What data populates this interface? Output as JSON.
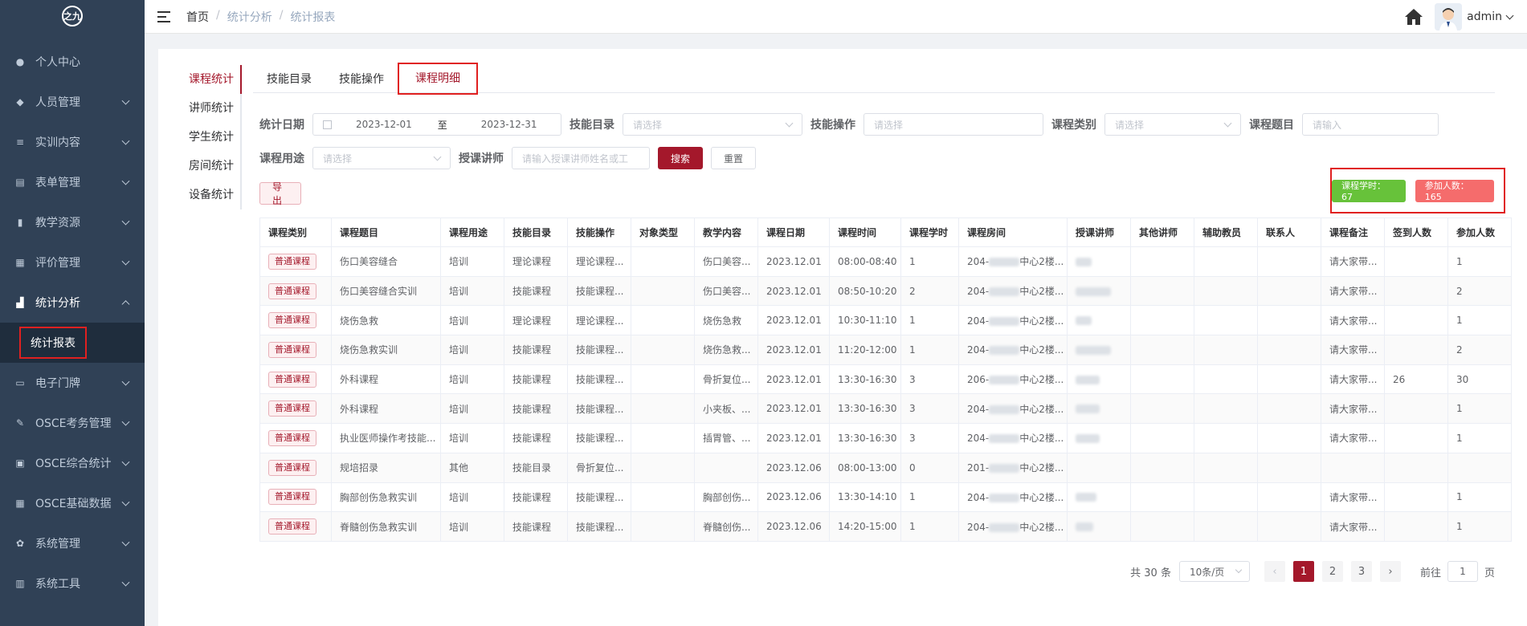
{
  "sidebar": {
    "logo": "之九",
    "items": [
      {
        "label": "个人中心",
        "icon": "user-icon",
        "has_children": false
      },
      {
        "label": "人员管理",
        "icon": "users-icon",
        "has_children": true
      },
      {
        "label": "实训内容",
        "icon": "list-icon",
        "has_children": true
      },
      {
        "label": "表单管理",
        "icon": "form-icon",
        "has_children": true
      },
      {
        "label": "教学资源",
        "icon": "book-icon",
        "has_children": true
      },
      {
        "label": "评价管理",
        "icon": "clipboard-icon",
        "has_children": true
      },
      {
        "label": "统计分析",
        "icon": "bar-chart-icon",
        "has_children": true,
        "open": true
      },
      {
        "label": "电子门牌",
        "icon": "monitor-icon",
        "has_children": true
      },
      {
        "label": "OSCE考务管理",
        "icon": "edit-icon",
        "has_children": true
      },
      {
        "label": "OSCE综合统计",
        "icon": "screen-icon",
        "has_children": true
      },
      {
        "label": "OSCE基础数据",
        "icon": "grid-icon",
        "has_children": true
      },
      {
        "label": "系统管理",
        "icon": "gear-icon",
        "has_children": true
      },
      {
        "label": "系统工具",
        "icon": "toolbox-icon",
        "has_children": true
      }
    ],
    "active_sub": "统计报表"
  },
  "header": {
    "breadcrumb": [
      "首页",
      "统计分析",
      "统计报表"
    ],
    "username": "admin"
  },
  "left_nav": [
    "课程统计",
    "讲师统计",
    "学生统计",
    "房间统计",
    "设备统计"
  ],
  "tabs": [
    "技能目录",
    "技能操作",
    "课程明细"
  ],
  "filters": {
    "date_label": "统计日期",
    "date_start": "2023-12-01",
    "date_sep": "至",
    "date_end": "2023-12-31",
    "skill_dir_label": "技能目录",
    "skill_dir_placeholder": "请选择",
    "skill_op_label": "技能操作",
    "skill_op_placeholder": "请选择",
    "course_type_label": "课程类别",
    "course_type_placeholder": "请选择",
    "course_title_label": "课程题目",
    "course_title_placeholder": "请输入",
    "purpose_label": "课程用途",
    "purpose_placeholder": "请选择",
    "teacher_label": "授课讲师",
    "teacher_placeholder": "请输入授课讲师姓名或工",
    "search_btn": "搜索",
    "reset_btn": "重置",
    "export_btn": "导出"
  },
  "stats": {
    "hours": "课程学时：  67",
    "attendees": "参加人数：  165"
  },
  "table": {
    "columns": [
      "课程类别",
      "课程题目",
      "课程用途",
      "技能目录",
      "技能操作",
      "对象类型",
      "教学内容",
      "课程日期",
      "课程时间",
      "课程学时",
      "课程房间",
      "授课讲师",
      "其他讲师",
      "辅助教员",
      "联系人",
      "课程备注",
      "签到人数",
      "参加人数"
    ],
    "rows": [
      {
        "type": "普通课程",
        "title": "伤口美容缝合",
        "purpose": "培训",
        "skill_dir": "理论课程",
        "skill_op": "理论课程...",
        "obj": "",
        "content": "伤口美容...",
        "date": "2023.12.01",
        "time": "08:00-08:40",
        "hours": "1",
        "room_a": "204-",
        "room_b": "中心2楼...",
        "teacher_w": 20,
        "note": "请大家带...",
        "signed": "",
        "attend": "1"
      },
      {
        "type": "普通课程",
        "title": "伤口美容缝合实训",
        "purpose": "培训",
        "skill_dir": "技能课程",
        "skill_op": "技能课程...",
        "obj": "",
        "content": "伤口美容...",
        "date": "2023.12.01",
        "time": "08:50-10:20",
        "hours": "2",
        "room_a": "204-",
        "room_b": "中心2楼...",
        "teacher_w": 44,
        "note": "请大家带...",
        "signed": "",
        "attend": "2"
      },
      {
        "type": "普通课程",
        "title": "烧伤急救",
        "purpose": "培训",
        "skill_dir": "理论课程",
        "skill_op": "理论课程...",
        "obj": "",
        "content": "烧伤急救",
        "date": "2023.12.01",
        "time": "10:30-11:10",
        "hours": "1",
        "room_a": "204-",
        "room_b": "中心2楼...",
        "teacher_w": 20,
        "note": "请大家带...",
        "signed": "",
        "attend": "1"
      },
      {
        "type": "普通课程",
        "title": "烧伤急救实训",
        "purpose": "培训",
        "skill_dir": "技能课程",
        "skill_op": "技能课程...",
        "obj": "",
        "content": "烧伤急救...",
        "date": "2023.12.01",
        "time": "11:20-12:00",
        "hours": "1",
        "room_a": "204-",
        "room_b": "中心2楼...",
        "teacher_w": 44,
        "note": "请大家带...",
        "signed": "",
        "attend": "2"
      },
      {
        "type": "普通课程",
        "title": "外科课程",
        "purpose": "培训",
        "skill_dir": "技能课程",
        "skill_op": "技能课程...",
        "obj": "",
        "content": "骨折复位...",
        "date": "2023.12.01",
        "time": "13:30-16:30",
        "hours": "3",
        "room_a": "206-",
        "room_b": "中心2楼...",
        "teacher_w": 30,
        "note": "请大家带...",
        "signed": "26",
        "attend": "30"
      },
      {
        "type": "普通课程",
        "title": "外科课程",
        "purpose": "培训",
        "skill_dir": "技能课程",
        "skill_op": "技能课程...",
        "obj": "",
        "content": "小夹板、...",
        "date": "2023.12.01",
        "time": "13:30-16:30",
        "hours": "3",
        "room_a": "204-",
        "room_b": "中心2楼...",
        "teacher_w": 30,
        "note": "请大家带...",
        "signed": "",
        "attend": "1"
      },
      {
        "type": "普通课程",
        "title": "执业医师操作考技能...",
        "purpose": "培训",
        "skill_dir": "技能课程",
        "skill_op": "技能课程...",
        "obj": "",
        "content": "插胃管、...",
        "date": "2023.12.01",
        "time": "13:30-16:30",
        "hours": "3",
        "room_a": "204-",
        "room_b": "中心2楼...",
        "teacher_w": 30,
        "note": "请大家带...",
        "signed": "",
        "attend": "1"
      },
      {
        "type": "普通课程",
        "title": "规培招录",
        "purpose": "其他",
        "skill_dir": "技能目录",
        "skill_op": "骨折复位...",
        "obj": "",
        "content": "",
        "date": "2023.12.06",
        "time": "08:00-13:00",
        "hours": "0",
        "room_a": "201-",
        "room_b": "中心2楼...",
        "teacher_w": 0,
        "note": "",
        "signed": "",
        "attend": ""
      },
      {
        "type": "普通课程",
        "title": "胸部创伤急救实训",
        "purpose": "培训",
        "skill_dir": "技能课程",
        "skill_op": "技能课程...",
        "obj": "",
        "content": "胸部创伤...",
        "date": "2023.12.06",
        "time": "13:30-14:10",
        "hours": "1",
        "room_a": "204-",
        "room_b": "中心2楼...",
        "teacher_w": 26,
        "note": "请大家带...",
        "signed": "",
        "attend": "1"
      },
      {
        "type": "普通课程",
        "title": "脊髓创伤急救实训",
        "purpose": "培训",
        "skill_dir": "技能课程",
        "skill_op": "技能课程...",
        "obj": "",
        "content": "脊髓创伤...",
        "date": "2023.12.06",
        "time": "14:20-15:00",
        "hours": "1",
        "room_a": "204-",
        "room_b": "中心2楼...",
        "teacher_w": 22,
        "note": "请大家带...",
        "signed": "",
        "attend": "1"
      }
    ]
  },
  "pagination": {
    "total": "共 30 条",
    "page_size": "10条/页",
    "pages": [
      "1",
      "2",
      "3"
    ],
    "prev": "‹",
    "next": "›",
    "goto_label": "前往",
    "goto_value": "1",
    "goto_suffix": "页"
  }
}
